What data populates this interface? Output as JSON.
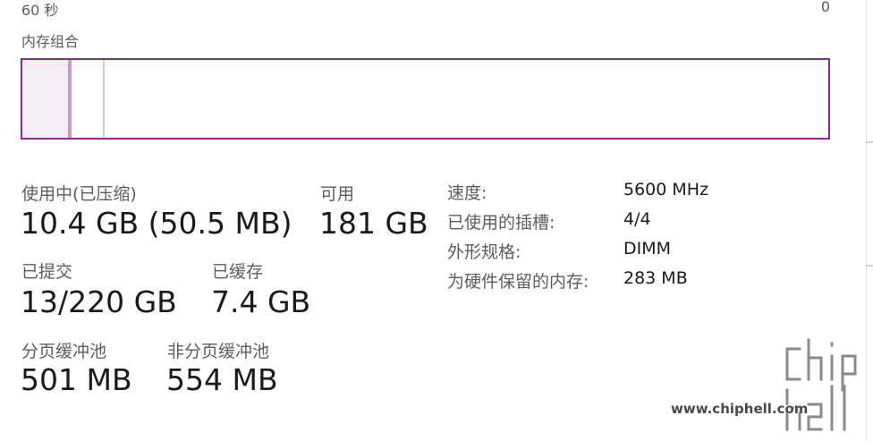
{
  "graph": {
    "axis_left_label": "60 秒",
    "axis_right_label": "0"
  },
  "composition": {
    "label": "内存组合",
    "in_use_fraction": 0.057,
    "modified_fraction": 0.004,
    "standby_fraction": 0.041,
    "border_color": "#8b2a8f"
  },
  "stats": {
    "in_use": {
      "label": "使用中(已压缩)",
      "value": "10.4 GB (50.5 MB)"
    },
    "available": {
      "label": "可用",
      "value": "181 GB"
    },
    "committed": {
      "label": "已提交",
      "value": "13/220 GB"
    },
    "cached": {
      "label": "已缓存",
      "value": "7.4 GB"
    },
    "paged_pool": {
      "label": "分页缓冲池",
      "value": "501 MB"
    },
    "nonpaged_pool": {
      "label": "非分页缓冲池",
      "value": "554 MB"
    }
  },
  "properties": [
    {
      "key": "速度:",
      "value": "5600 MHz"
    },
    {
      "key": "已使用的插槽:",
      "value": "4/4"
    },
    {
      "key": "外形规格:",
      "value": "DIMM"
    },
    {
      "key": "为硬件保留的内存:",
      "value": "283 MB"
    }
  ],
  "watermark": {
    "url": "www.chiphell.com",
    "logo_text": "chip hell"
  }
}
